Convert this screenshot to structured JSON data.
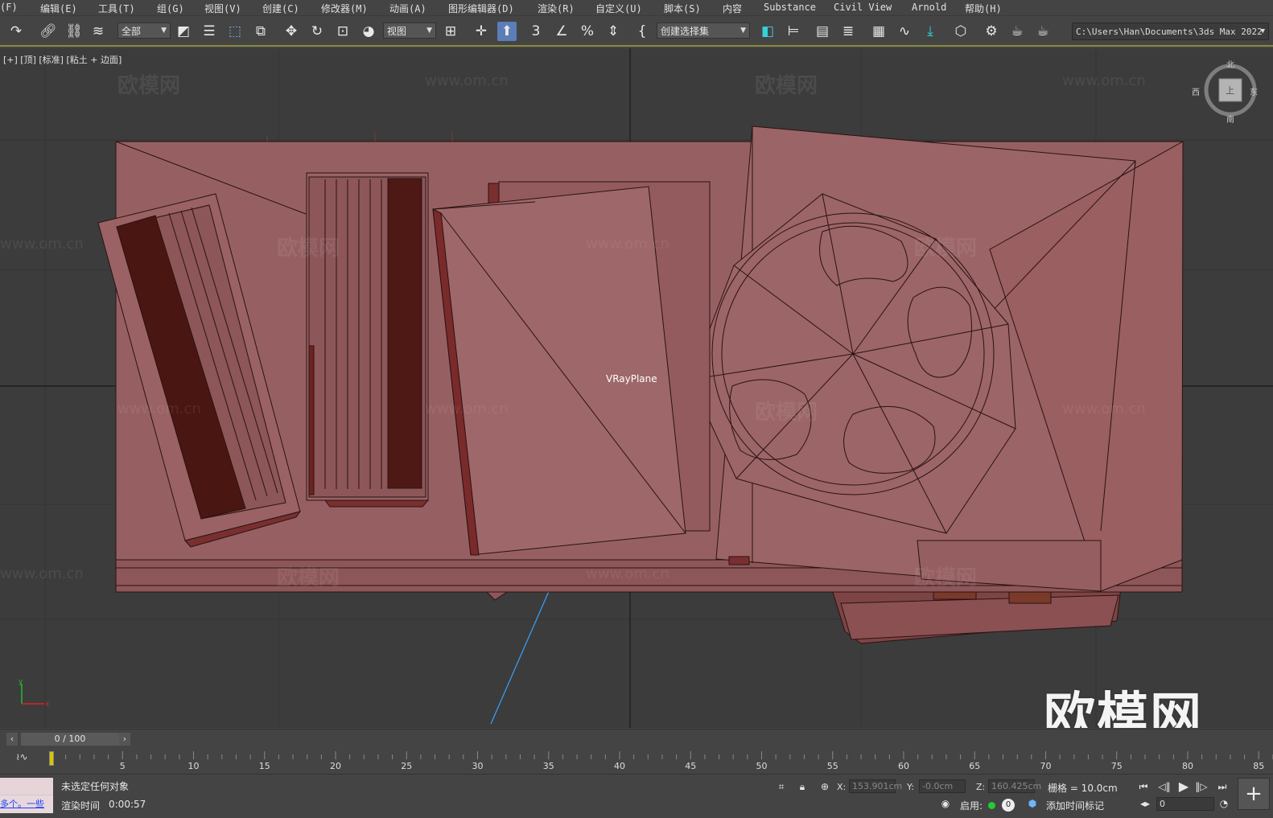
{
  "menu": {
    "items": [
      "(F)",
      "编辑(E)",
      "工具(T)",
      "组(G)",
      "视图(V)",
      "创建(C)",
      "修改器(M)",
      "动画(A)",
      "图形编辑器(D)",
      "渲染(R)",
      "自定义(U)",
      "脚本(S)",
      "内容",
      "Substance",
      "Civil View",
      "Arnold",
      "帮助(H)"
    ]
  },
  "toolbar": {
    "selection_filter": "全部",
    "ref_coord": "视图",
    "named_selection": "创建选择集",
    "project_path": "C:\\Users\\Han\\Documents\\3ds Max 2022",
    "snap_toggle_label": "3",
    "accent_color": "#5b7db8"
  },
  "viewport": {
    "label": "[+] [顶] [标准] [粘土 + 边面]",
    "object_label": "VRayPlane",
    "watermark_cn": "欧模网",
    "watermark_url": "www.om.cn",
    "logo_text": "欧模网",
    "viewcube": {
      "north": "北",
      "south": "南",
      "east": "东",
      "west": "西",
      "face": "上"
    },
    "model_color": "#966062"
  },
  "timeline": {
    "frame_display": "0 / 100",
    "ticks": [
      "5",
      "10",
      "15",
      "20",
      "25",
      "30",
      "35",
      "40",
      "45",
      "50",
      "55",
      "60",
      "65",
      "70",
      "75",
      "80",
      "85"
    ]
  },
  "status": {
    "maxscript_text": "多个。一些",
    "selection_status": "未选定任何对象",
    "render_time_label": "渲染时间",
    "render_time_value": "0:00:57",
    "x_label": "X:",
    "x_value": "153.901cm",
    "y_label": "Y:",
    "y_value": "-0.0cm",
    "z_label": "Z:",
    "z_value": "160.425cm",
    "grid_label": "栅格 = 10.0cm",
    "enable_label": "启用:",
    "enable_count": "0",
    "add_time_tag": "添加时间标记",
    "current_frame": "0"
  }
}
